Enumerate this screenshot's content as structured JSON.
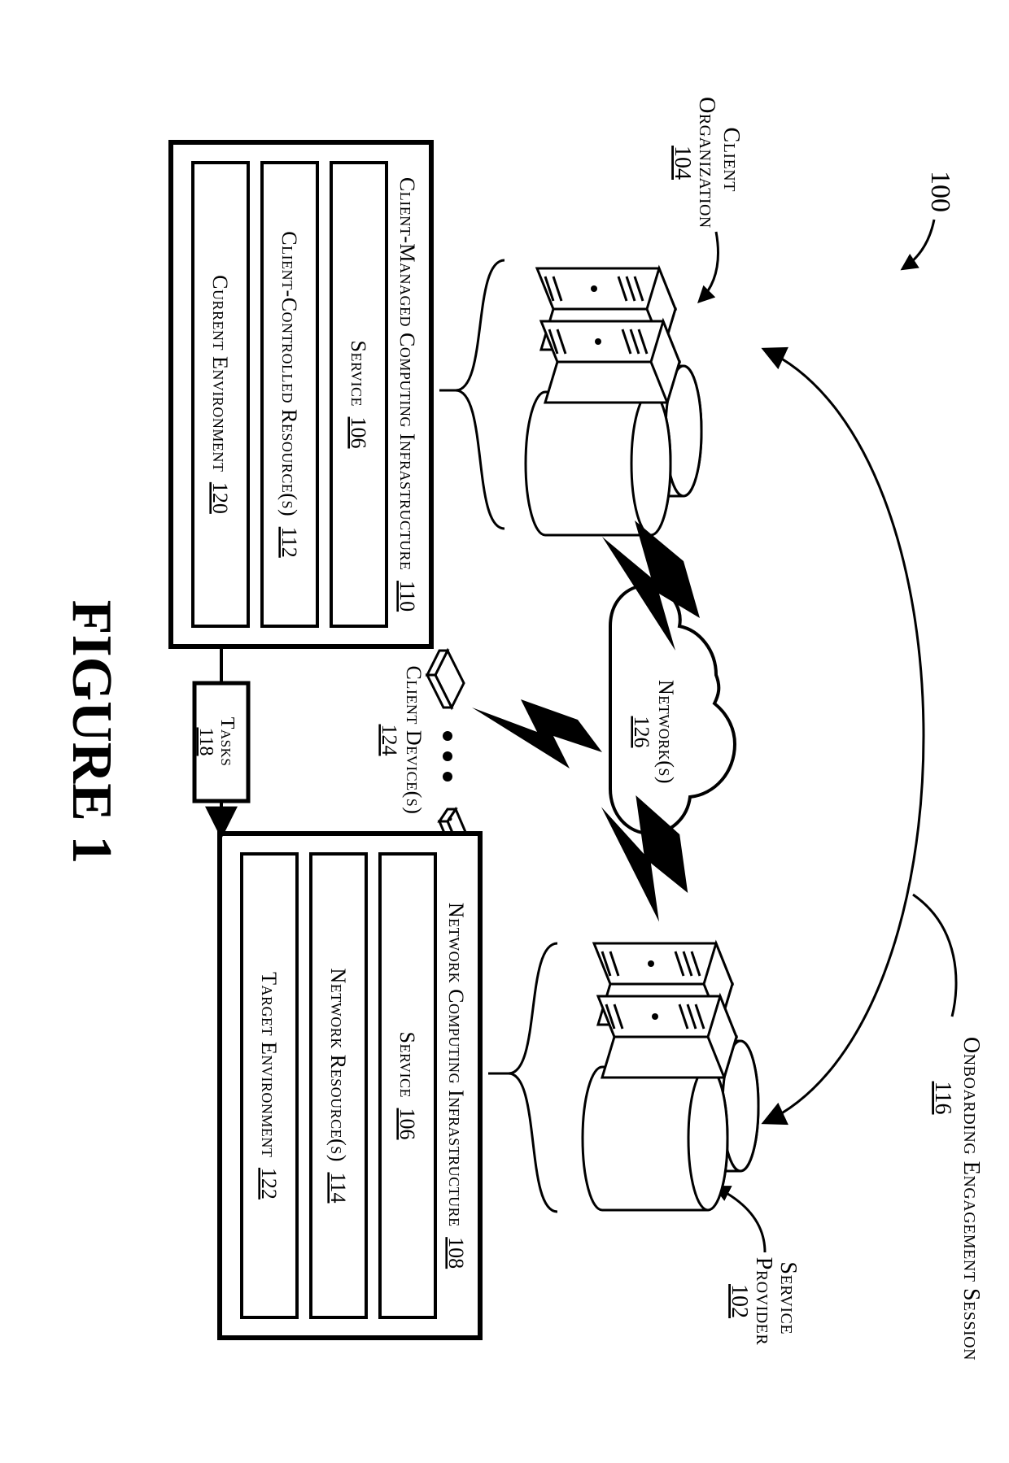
{
  "figure": {
    "number_label": "100",
    "title": "FIGURE 1",
    "session_label": "Onboarding Engagement Session",
    "session_ref": "116"
  },
  "network": {
    "label": "Network(s)",
    "ref": "126"
  },
  "client_devices": {
    "label": "Client Device(s)",
    "ref": "124"
  },
  "tasks": {
    "label": "Tasks",
    "ref": "118"
  },
  "client_org": {
    "label": "Client Organization",
    "ref": "104"
  },
  "service_provider": {
    "label": "Service Provider",
    "ref": "102"
  },
  "left_box": {
    "title": "Client-Managed Computing Infrastructure",
    "ref": "110",
    "rows": [
      {
        "label": "Service",
        "ref": "106"
      },
      {
        "label": "Client-Controlled Resource(s)",
        "ref": "112"
      },
      {
        "label": "Current Environment",
        "ref": "120"
      }
    ]
  },
  "right_box": {
    "title": "Network Computing Infrastructure",
    "ref": "108",
    "rows": [
      {
        "label": "Service",
        "ref": "106"
      },
      {
        "label": "Network Resource(s)",
        "ref": "114"
      },
      {
        "label": "Target Environment",
        "ref": "122"
      }
    ]
  }
}
